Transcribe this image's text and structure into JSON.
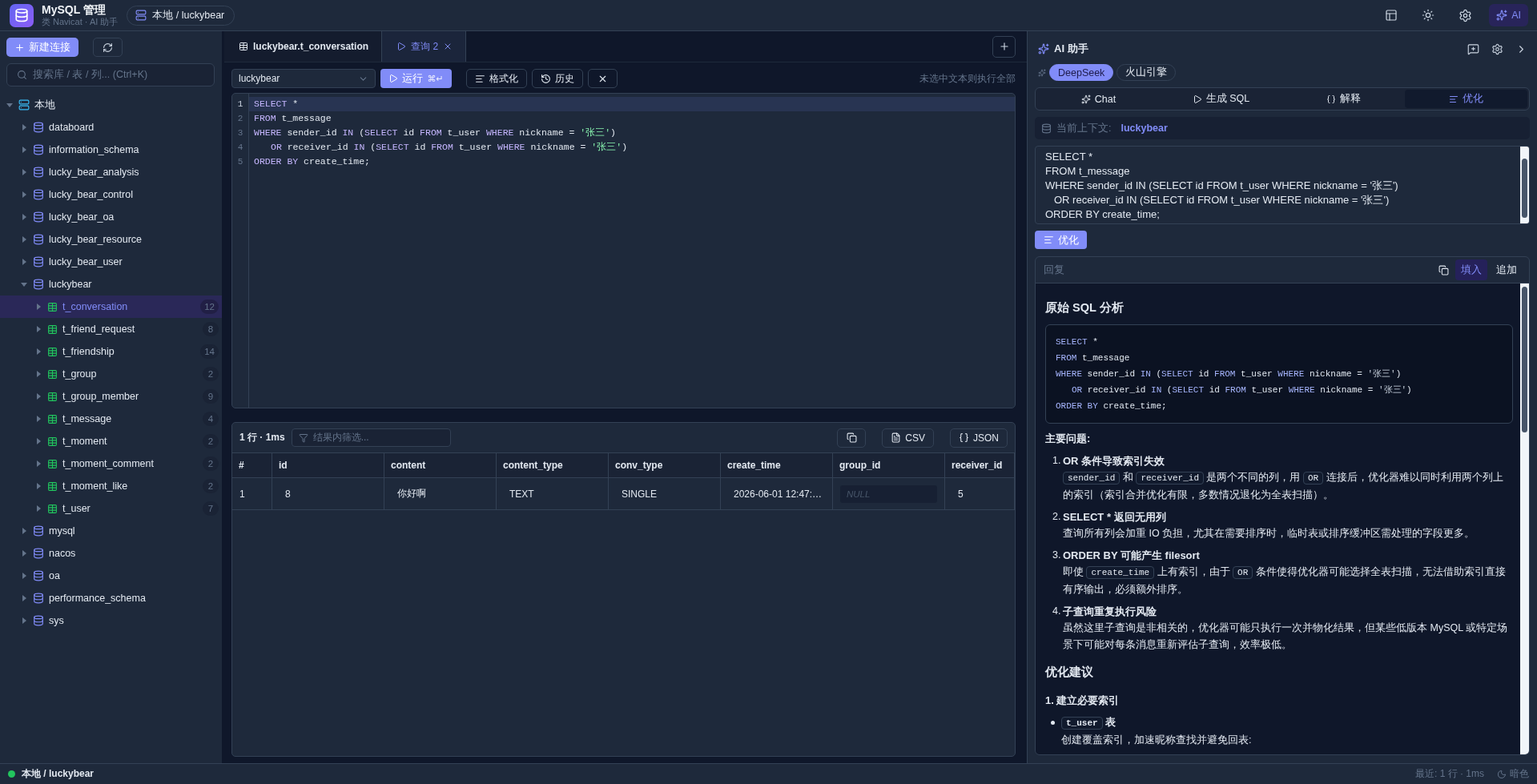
{
  "header": {
    "title": "MySQL 管理",
    "subtitle": "类 Navicat · AI 助手",
    "breadcrumb": "本地 / luckybear",
    "ai_button": {
      "label": "AI",
      "selected": true
    }
  },
  "sidebar": {
    "new_button": "新建连接",
    "search": {
      "placeholder": "搜索库 / 表 / 列... (Ctrl+K)"
    },
    "tree": [
      {
        "kind": "server",
        "label": "本地",
        "expanded": true,
        "selected": false,
        "children": [
          {
            "kind": "database",
            "label": "databoard",
            "expanded": false,
            "selected": false
          },
          {
            "kind": "database",
            "label": "information_schema",
            "expanded": false,
            "selected": false
          },
          {
            "kind": "database",
            "label": "lucky_bear_analysis",
            "expanded": false,
            "selected": false
          },
          {
            "kind": "database",
            "label": "lucky_bear_control",
            "expanded": false,
            "selected": false
          },
          {
            "kind": "database",
            "label": "lucky_bear_oa",
            "expanded": false,
            "selected": false
          },
          {
            "kind": "database",
            "label": "lucky_bear_resource",
            "expanded": false,
            "selected": false
          },
          {
            "kind": "database",
            "label": "lucky_bear_user",
            "expanded": false,
            "selected": false
          },
          {
            "kind": "database",
            "label": "luckybear",
            "expanded": true,
            "selected": false,
            "children": [
              {
                "kind": "table",
                "label": "t_conversation",
                "count": "12",
                "expanded": false,
                "selected": true
              },
              {
                "kind": "table",
                "label": "t_friend_request",
                "count": "8",
                "expanded": false,
                "selected": false
              },
              {
                "kind": "table",
                "label": "t_friendship",
                "count": "14",
                "expanded": false,
                "selected": false
              },
              {
                "kind": "table",
                "label": "t_group",
                "count": "2",
                "expanded": false,
                "selected": false
              },
              {
                "kind": "table",
                "label": "t_group_member",
                "count": "9",
                "expanded": false,
                "selected": false
              },
              {
                "kind": "table",
                "label": "t_message",
                "count": "4",
                "expanded": false,
                "selected": false
              },
              {
                "kind": "table",
                "label": "t_moment",
                "count": "2",
                "expanded": false,
                "selected": false
              },
              {
                "kind": "table",
                "label": "t_moment_comment",
                "count": "2",
                "expanded": false,
                "selected": false
              },
              {
                "kind": "table",
                "label": "t_moment_like",
                "count": "2",
                "expanded": false,
                "selected": false
              },
              {
                "kind": "table",
                "label": "t_user",
                "count": "7",
                "expanded": false,
                "selected": false
              }
            ]
          },
          {
            "kind": "database",
            "label": "mysql",
            "expanded": false,
            "selected": false
          },
          {
            "kind": "database",
            "label": "nacos",
            "expanded": false,
            "selected": false
          },
          {
            "kind": "database",
            "label": "oa",
            "expanded": false,
            "selected": false
          },
          {
            "kind": "database",
            "label": "performance_schema",
            "expanded": false,
            "selected": false
          },
          {
            "kind": "database",
            "label": "sys",
            "expanded": false,
            "selected": false
          }
        ]
      }
    ]
  },
  "editor_tabs": [
    {
      "kind": "table",
      "label": "luckybear.t_conversation",
      "selected": false,
      "closable": false
    },
    {
      "kind": "query",
      "label": "查询 2",
      "selected": true,
      "closable": true
    }
  ],
  "toolbar": {
    "database": "luckybear",
    "run": {
      "label": "运行",
      "shortcut": "⌘↵"
    },
    "format": "格式化",
    "history": "历史",
    "hint": "未选中文本则执行全部"
  },
  "editor": {
    "lines": [
      {
        "number": "1",
        "active": true,
        "indent": false,
        "tokens": [
          {
            "kind": "keyword",
            "text": "SELECT"
          },
          {
            "kind": "plain",
            "text": " *"
          }
        ]
      },
      {
        "number": "2",
        "active": false,
        "indent": false,
        "tokens": [
          {
            "kind": "keyword",
            "text": "FROM"
          },
          {
            "kind": "plain",
            "text": " t_message"
          }
        ]
      },
      {
        "number": "3",
        "active": false,
        "indent": false,
        "tokens": [
          {
            "kind": "keyword",
            "text": "WHERE"
          },
          {
            "kind": "plain",
            "text": " sender_id "
          },
          {
            "kind": "keyword",
            "text": "IN"
          },
          {
            "kind": "plain",
            "text": " ("
          },
          {
            "kind": "keyword",
            "text": "SELECT"
          },
          {
            "kind": "plain",
            "text": " id "
          },
          {
            "kind": "keyword",
            "text": "FROM"
          },
          {
            "kind": "plain",
            "text": " t_user "
          },
          {
            "kind": "keyword",
            "text": "WHERE"
          },
          {
            "kind": "plain",
            "text": " nickname = "
          },
          {
            "kind": "string",
            "text": "'张三'"
          },
          {
            "kind": "plain",
            "text": ")"
          }
        ]
      },
      {
        "number": "4",
        "active": false,
        "indent": true,
        "tokens": [
          {
            "kind": "keyword",
            "text": "OR"
          },
          {
            "kind": "plain",
            "text": " receiver_id "
          },
          {
            "kind": "keyword",
            "text": "IN"
          },
          {
            "kind": "plain",
            "text": " ("
          },
          {
            "kind": "keyword",
            "text": "SELECT"
          },
          {
            "kind": "plain",
            "text": " id "
          },
          {
            "kind": "keyword",
            "text": "FROM"
          },
          {
            "kind": "plain",
            "text": " t_user "
          },
          {
            "kind": "keyword",
            "text": "WHERE"
          },
          {
            "kind": "plain",
            "text": " nickname = "
          },
          {
            "kind": "string",
            "text": "'张三'"
          },
          {
            "kind": "plain",
            "text": ")"
          }
        ]
      },
      {
        "number": "5",
        "active": false,
        "indent": false,
        "tokens": [
          {
            "kind": "keyword",
            "text": "ORDER BY"
          },
          {
            "kind": "plain",
            "text": " create_time;"
          }
        ]
      }
    ]
  },
  "results": {
    "summary": "1 行 · 1ms",
    "filter": {
      "placeholder": "结果内筛选..."
    },
    "exports": [
      {
        "kind": "csv",
        "label": "CSV"
      },
      {
        "kind": "json",
        "label": "JSON"
      }
    ],
    "columns": [
      "#",
      "id",
      "content",
      "content_type",
      "conv_type",
      "create_time",
      "group_id",
      "receiver_id"
    ],
    "rows": [
      [
        {
          "kind": "index",
          "text": "1"
        },
        {
          "kind": "value",
          "text": "8"
        },
        {
          "kind": "value",
          "text": "你好啊"
        },
        {
          "kind": "value",
          "text": "TEXT"
        },
        {
          "kind": "value",
          "text": "SINGLE"
        },
        {
          "kind": "value",
          "text": "2026-06-01 12:47:…"
        },
        {
          "kind": "null",
          "text": "NULL"
        },
        {
          "kind": "value",
          "text": "5"
        }
      ]
    ]
  },
  "ai_panel": {
    "title": "AI 助手",
    "providers": [
      {
        "label": "DeepSeek",
        "selected": true
      },
      {
        "label": "火山引擎",
        "selected": false
      }
    ],
    "modes": [
      {
        "kind": "chat",
        "label": "Chat",
        "selected": false
      },
      {
        "kind": "generate",
        "label": "生成 SQL",
        "selected": false
      },
      {
        "kind": "explain",
        "label": "解释",
        "selected": false
      },
      {
        "kind": "optimize",
        "label": "优化",
        "selected": true
      }
    ],
    "context": {
      "label": "当前上下文:",
      "value": "luckybear"
    },
    "input_lines": [
      {
        "text": "SELECT *",
        "indent": false
      },
      {
        "text": "FROM t_message",
        "indent": false
      },
      {
        "text": "WHERE sender_id IN (SELECT id FROM t_user WHERE nickname = '张三')",
        "indent": false
      },
      {
        "text": "OR receiver_id IN (SELECT id FROM t_user WHERE nickname = '张三')",
        "indent": true
      },
      {
        "text": "ORDER BY create_time;",
        "indent": false
      }
    ],
    "action_button": "优化",
    "reply": {
      "label": "回复",
      "actions": [
        {
          "label": "填入",
          "selected": true
        },
        {
          "label": "追加",
          "selected": false
        }
      ],
      "content": [
        {
          "kind": "heading",
          "text": "原始 SQL 分析"
        },
        {
          "kind": "code",
          "lines": [
            {
              "indent": false,
              "tokens": [
                {
                  "kind": "keyword",
                  "text": "SELECT"
                },
                {
                  "kind": "plain",
                  "text": " *"
                }
              ]
            },
            {
              "indent": false,
              "tokens": [
                {
                  "kind": "keyword",
                  "text": "FROM"
                },
                {
                  "kind": "plain",
                  "text": " t_message"
                }
              ]
            },
            {
              "indent": false,
              "tokens": [
                {
                  "kind": "keyword",
                  "text": "WHERE"
                },
                {
                  "kind": "plain",
                  "text": " sender_id "
                },
                {
                  "kind": "keyword",
                  "text": "IN"
                },
                {
                  "kind": "plain",
                  "text": " ("
                },
                {
                  "kind": "keyword",
                  "text": "SELECT"
                },
                {
                  "kind": "plain",
                  "text": " id "
                },
                {
                  "kind": "keyword",
                  "text": "FROM"
                },
                {
                  "kind": "plain",
                  "text": " t_user "
                },
                {
                  "kind": "keyword",
                  "text": "WHERE"
                },
                {
                  "kind": "plain",
                  "text": " nickname = "
                },
                {
                  "kind": "string",
                  "text": "'张三'"
                },
                {
                  "kind": "plain",
                  "text": ")"
                }
              ]
            },
            {
              "indent": true,
              "tokens": [
                {
                  "kind": "keyword",
                  "text": "OR"
                },
                {
                  "kind": "plain",
                  "text": " receiver_id "
                },
                {
                  "kind": "keyword",
                  "text": "IN"
                },
                {
                  "kind": "plain",
                  "text": " ("
                },
                {
                  "kind": "keyword",
                  "text": "SELECT"
                },
                {
                  "kind": "plain",
                  "text": " id "
                },
                {
                  "kind": "keyword",
                  "text": "FROM"
                },
                {
                  "kind": "plain",
                  "text": " t_user "
                },
                {
                  "kind": "keyword",
                  "text": "WHERE"
                },
                {
                  "kind": "plain",
                  "text": " nickname = "
                },
                {
                  "kind": "string",
                  "text": "'张三'"
                },
                {
                  "kind": "plain",
                  "text": ")"
                }
              ]
            },
            {
              "indent": false,
              "tokens": [
                {
                  "kind": "keyword",
                  "text": "ORDER BY"
                },
                {
                  "kind": "plain",
                  "text": " create_time;"
                }
              ]
            }
          ]
        },
        {
          "kind": "label",
          "text": "主要问题:"
        },
        {
          "kind": "ordered_list",
          "items": [
            {
              "number": "1.",
              "title": "OR 条件导致索引失效",
              "body": [
                {
                  "kind": "code",
                  "text": "sender_id"
                },
                {
                  "kind": "text",
                  "text": " 和 "
                },
                {
                  "kind": "code",
                  "text": "receiver_id"
                },
                {
                  "kind": "text",
                  "text": " 是两个不同的列，用 "
                },
                {
                  "kind": "code",
                  "text": "OR"
                },
                {
                  "kind": "text",
                  "text": " 连接后，优化器难以同时利用两个列上的索引（索引合并优化有限，多数情况退化为全表扫描）。"
                }
              ]
            },
            {
              "number": "2.",
              "title": "SELECT * 返回无用列",
              "body": [
                {
                  "kind": "text",
                  "text": "查询所有列会加重 IO 负担，尤其在需要排序时，临时表或排序缓冲区需处理的字段更多。"
                }
              ]
            },
            {
              "number": "3.",
              "title": "ORDER BY 可能产生 filesort",
              "body": [
                {
                  "kind": "text",
                  "text": "即使 "
                },
                {
                  "kind": "code",
                  "text": "create_time"
                },
                {
                  "kind": "text",
                  "text": " 上有索引，由于 "
                },
                {
                  "kind": "code",
                  "text": "OR"
                },
                {
                  "kind": "text",
                  "text": " 条件使得优化器可能选择全表扫描，无法借助索引直接有序输出，必须额外排序。"
                }
              ]
            },
            {
              "number": "4.",
              "title": "子查询重复执行风险",
              "body": [
                {
                  "kind": "text",
                  "text": "虽然这里子查询是非相关的，优化器可能只执行一次并物化结果，但某些低版本 MySQL 或特定场景下可能对每条消息重新评估子查询，效率极低。"
                }
              ]
            }
          ]
        },
        {
          "kind": "heading",
          "text": "优化建议"
        },
        {
          "kind": "subheading",
          "text": "1. 建立必要索引"
        },
        {
          "kind": "bullet_list",
          "items": [
            {
              "title": [
                {
                  "kind": "code",
                  "text": "t_user"
                },
                {
                  "kind": "text",
                  "text": " 表"
                }
              ],
              "body": [
                {
                  "kind": "text",
                  "text": "创建覆盖索引，加速昵称查找并避免回表:"
                }
              ]
            }
          ]
        }
      ]
    }
  },
  "status_bar": {
    "connection": "本地 / luckybear",
    "connected": true,
    "recent": "最近: 1 行 · 1ms",
    "theme": "暗色"
  }
}
